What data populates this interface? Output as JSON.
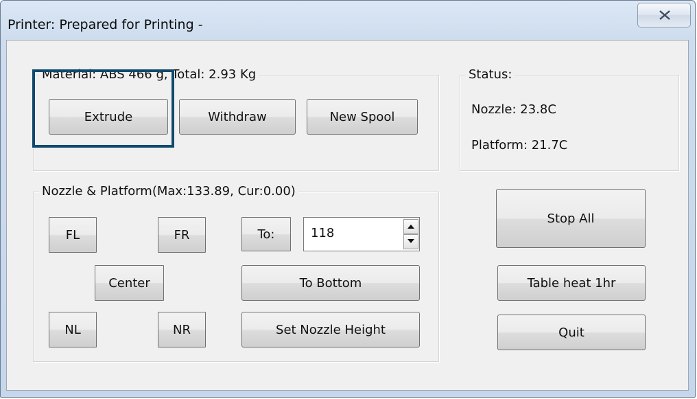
{
  "window": {
    "title": "Printer: Prepared for Printing -"
  },
  "material": {
    "legend": "Material: ABS 466 g,  Total: 2.93 Kg",
    "extrude_label": "Extrude",
    "withdraw_label": "Withdraw",
    "new_spool_label": "New Spool"
  },
  "status": {
    "legend": "Status:",
    "nozzle": "Nozzle: 23.8C",
    "platform": "Platform: 21.7C"
  },
  "nozzle_platform": {
    "legend": "Nozzle & Platform(Max:133.89, Cur:0.00)",
    "fl_label": "FL",
    "fr_label": "FR",
    "center_label": "Center",
    "nl_label": "NL",
    "nr_label": "NR",
    "to_label": "To:",
    "to_value": "118",
    "to_bottom_label": "To Bottom",
    "set_nozzle_height_label": "Set Nozzle Height"
  },
  "actions": {
    "stop_all_label": "Stop All",
    "table_heat_label": "Table heat 1hr",
    "quit_label": "Quit"
  },
  "icons": {
    "close": "close-icon",
    "spin_up": "arrow-up-icon",
    "spin_down": "arrow-down-icon"
  },
  "colors": {
    "focus_ring": "#0f4a6e",
    "client_bg": "#f0f0f0",
    "frame": "#cddcee"
  }
}
